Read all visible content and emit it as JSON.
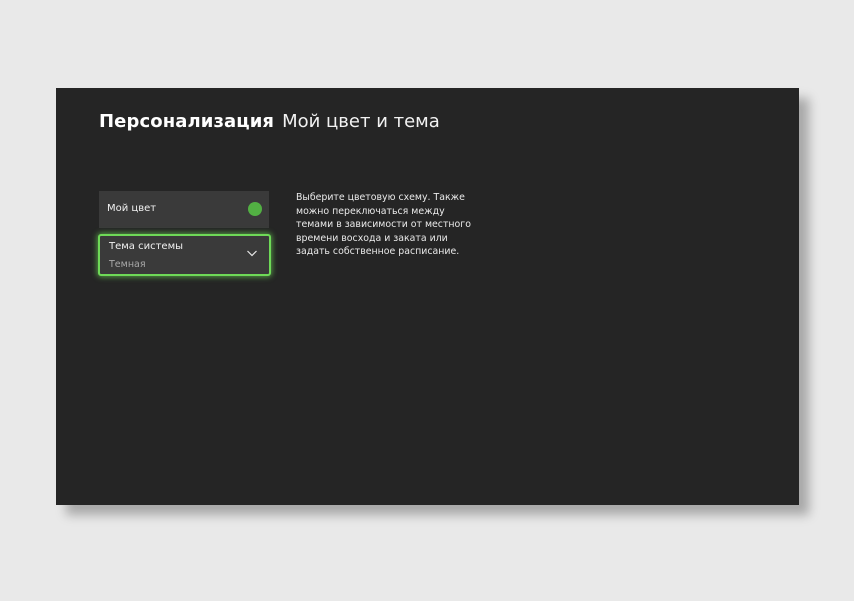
{
  "header": {
    "section": "Персонализация",
    "page": "Мой цвет и тема"
  },
  "settings": {
    "my_color": {
      "label": "Мой цвет",
      "swatch_color": "#52b043",
      "icon": "color-dot-icon"
    },
    "system_theme": {
      "label": "Тема системы",
      "value": "Темная",
      "icon": "chevron-down-icon"
    }
  },
  "description": "Выберите цветовую схему. Также можно переключаться между темами в зависимости от местного времени восхода и заката или задать собственное расписание.",
  "colors": {
    "background": "#252525",
    "item_background": "#3a3a3a",
    "focus_accent": "#6ed957"
  }
}
